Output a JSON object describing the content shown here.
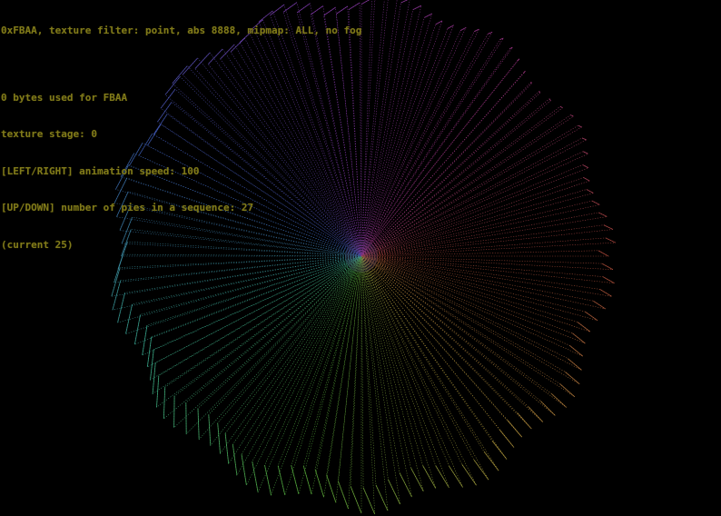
{
  "hud": {
    "title": "0xFBAA, texture filter: point, abs 8888, mipmap: ALL, no fog",
    "bytes_used": "0 bytes used for FBAA",
    "texture_stage": "texture stage: 0",
    "animation_speed": "[LEFT/RIGHT] animation speed: 100",
    "pies_in_sequence": "[UP/DOWN] number of pies in a sequence: 27",
    "current": "(current 25)"
  },
  "scene": {
    "wedge_count": 120,
    "background": "#000000",
    "palette": [
      "#c05040",
      "#c0a040",
      "#60c040",
      "#40c0a0",
      "#4060c0",
      "#9040c0",
      "#c040a0"
    ]
  },
  "colors": {
    "hud_text": "#807a1a"
  }
}
